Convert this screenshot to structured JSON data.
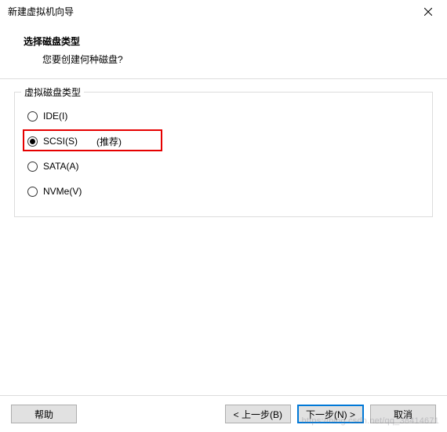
{
  "titlebar": {
    "text": "新建虚拟机向导"
  },
  "header": {
    "title": "选择磁盘类型",
    "subtitle": "您要创建何种磁盘?"
  },
  "group": {
    "legend": "虚拟磁盘类型",
    "options": [
      {
        "label": "IDE(I)",
        "hint": "",
        "selected": false
      },
      {
        "label": "SCSI(S)",
        "hint": "(推荐)",
        "selected": true
      },
      {
        "label": "SATA(A)",
        "hint": "",
        "selected": false
      },
      {
        "label": "NVMe(V)",
        "hint": "",
        "selected": false
      }
    ]
  },
  "footer": {
    "help": "帮助",
    "back": "< 上一步(B)",
    "next": "下一步(N) >",
    "cancel": "取消"
  },
  "watermark": "https://blog.csdn.net/qq_38414671"
}
